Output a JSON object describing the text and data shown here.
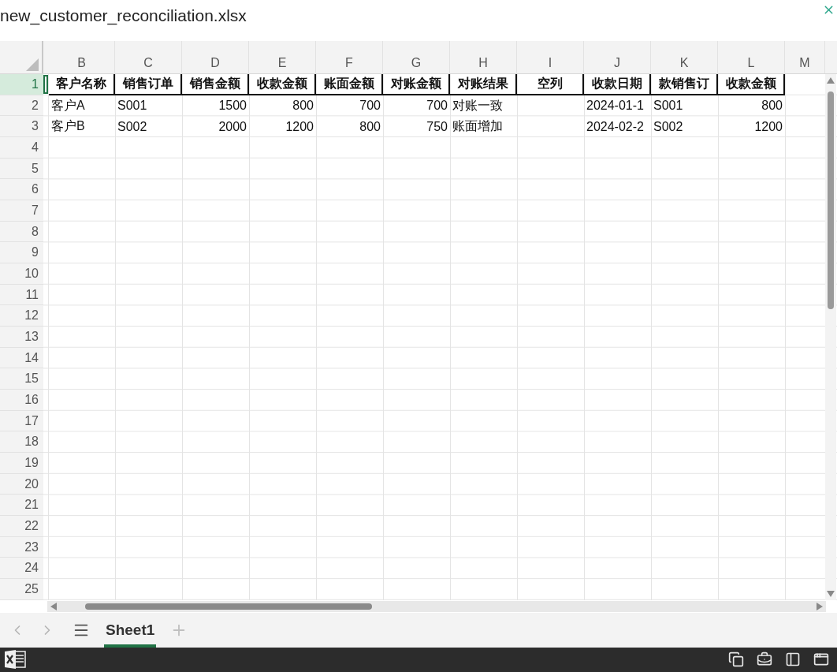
{
  "window": {
    "title": "new_customer_reconciliation.xlsx"
  },
  "columns": [
    {
      "letter": "B",
      "numeric": false
    },
    {
      "letter": "C",
      "numeric": false
    },
    {
      "letter": "D",
      "numeric": true
    },
    {
      "letter": "E",
      "numeric": true
    },
    {
      "letter": "F",
      "numeric": true
    },
    {
      "letter": "G",
      "numeric": true
    },
    {
      "letter": "H",
      "numeric": false
    },
    {
      "letter": "I"
    },
    {
      "letter": "J",
      "numeric": false
    },
    {
      "letter": "K",
      "numeric": false
    },
    {
      "letter": "L",
      "numeric": true
    },
    {
      "letter": "M"
    }
  ],
  "rows": [
    {
      "number": "1",
      "selected": true,
      "kind": "header",
      "cells": [
        "客户名称",
        "销售订单",
        "销售金额",
        "收款金额",
        "账面金额",
        "对账金额",
        "对账结果",
        "空列",
        "收款日期",
        "款销售订",
        "收款金额"
      ]
    },
    {
      "number": "2",
      "selected": false,
      "kind": "data",
      "cells": [
        "客户A",
        "S001",
        "1500",
        "800",
        "700",
        "700",
        "对账一致",
        null,
        "2024-01-1",
        "S001",
        "800"
      ]
    },
    {
      "number": "3",
      "selected": false,
      "kind": "data",
      "cells": [
        "客户B",
        "S002",
        "2000",
        "1200",
        "800",
        "750",
        "账面增加",
        null,
        "2024-02-2",
        "S002",
        "1200"
      ]
    },
    {
      "number": "4",
      "selected": false
    },
    {
      "number": "5",
      "selected": false
    },
    {
      "number": "6",
      "selected": false
    },
    {
      "number": "7",
      "selected": false
    },
    {
      "number": "8",
      "selected": false
    },
    {
      "number": "9",
      "selected": false
    },
    {
      "number": "10",
      "selected": false
    },
    {
      "number": "11",
      "selected": false
    },
    {
      "number": "12",
      "selected": false
    },
    {
      "number": "13",
      "selected": false
    },
    {
      "number": "14",
      "selected": false
    },
    {
      "number": "15",
      "selected": false
    },
    {
      "number": "16",
      "selected": false
    },
    {
      "number": "17",
      "selected": false
    },
    {
      "number": "18",
      "selected": false
    },
    {
      "number": "19",
      "selected": false
    },
    {
      "number": "20",
      "selected": false
    },
    {
      "number": "21",
      "selected": false
    },
    {
      "number": "22",
      "selected": false
    },
    {
      "number": "23",
      "selected": false
    },
    {
      "number": "24",
      "selected": false
    },
    {
      "number": "25",
      "selected": false
    }
  ],
  "sheets": [
    {
      "label": "Sheet1",
      "selected": true
    }
  ]
}
